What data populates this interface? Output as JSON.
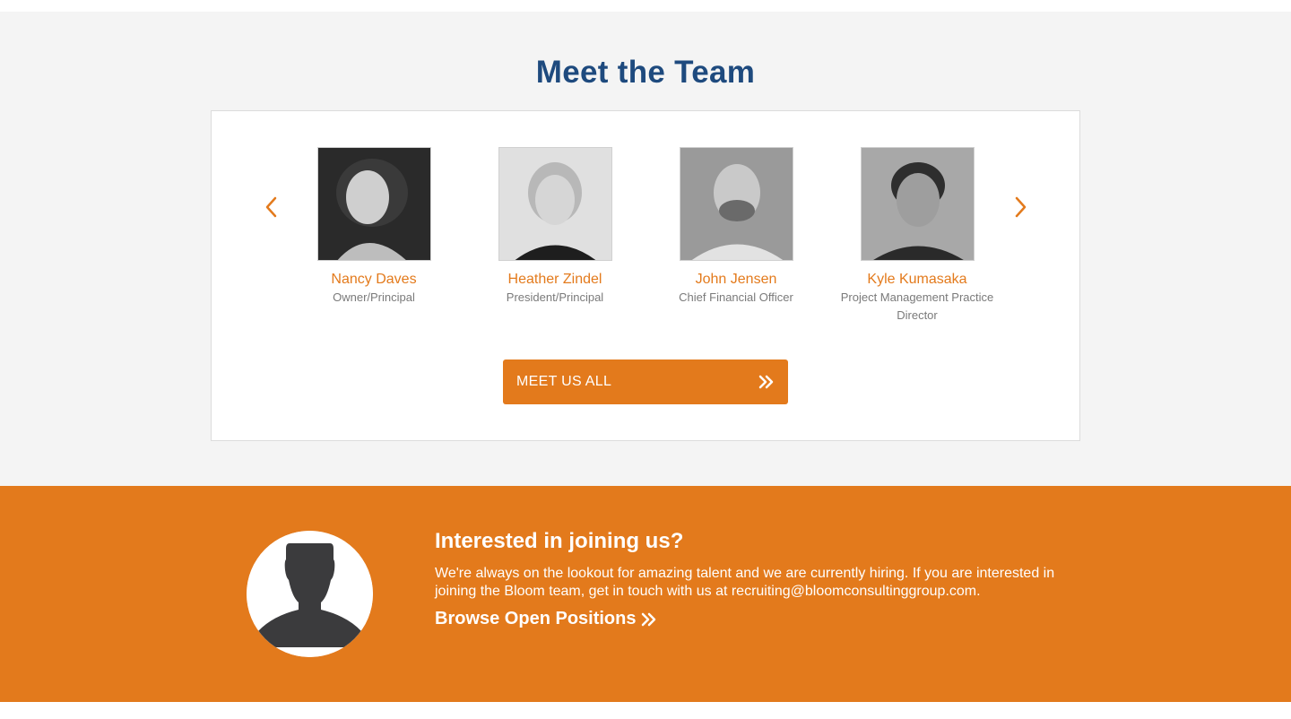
{
  "team": {
    "title": "Meet the Team",
    "members": [
      {
        "name": "Nancy Daves",
        "role": "Owner/Principal"
      },
      {
        "name": "Heather Zindel",
        "role": "President/Principal"
      },
      {
        "name": "John Jensen",
        "role": "Chief Financial Officer"
      },
      {
        "name": "Kyle Kumasaka",
        "role": "Project Management Practice Director"
      }
    ],
    "cta_label": "MEET US ALL",
    "prev_icon": "chevron-left-icon",
    "next_icon": "chevron-right-icon"
  },
  "join": {
    "title": "Interested in joining us?",
    "text": "We're always on the lookout for amazing talent and we are currently hiring. If you are interested in joining the Bloom team, get in touch with us at recruiting@bloomconsultinggroup.com.",
    "link_label": "Browse Open Positions"
  },
  "colors": {
    "accent": "#e37a1c",
    "title_blue": "#1e4a7e",
    "section_bg": "#f4f4f4"
  }
}
